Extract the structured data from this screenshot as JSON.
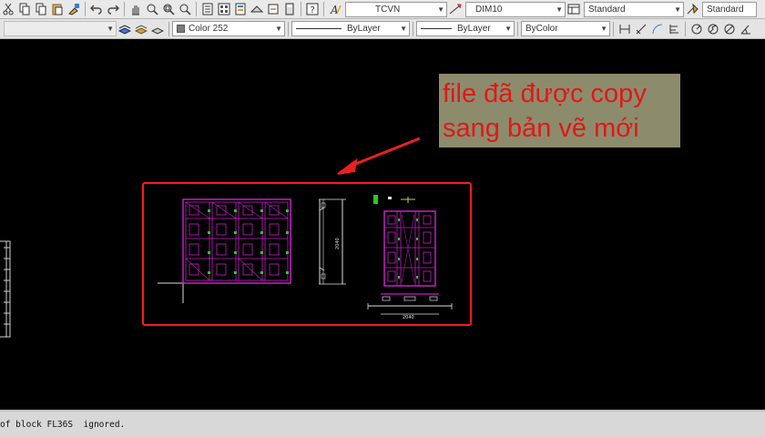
{
  "toolbar": {
    "text_style": "TCVN",
    "dim_style": "DIM10",
    "table_style": "Standard",
    "multileader_style": "Standard",
    "color": "Color 252",
    "linetype": "ByLayer",
    "lineweight": "ByLayer",
    "plot_style": "ByColor"
  },
  "drawing": {
    "callout_line1": "file đã được copy",
    "callout_line2": "sang bản vẽ mới",
    "dimension_text_1": "2040",
    "dimension_text_2": "2040"
  },
  "command_line": {
    "text": "of block FL36S  ignored."
  },
  "colors": {
    "highlight_box": "#ff1a1a",
    "arrow": "#e82020",
    "geometry": "#c81ec8",
    "callout_text": "#e01818",
    "callout_background": "#8c8c6c"
  }
}
